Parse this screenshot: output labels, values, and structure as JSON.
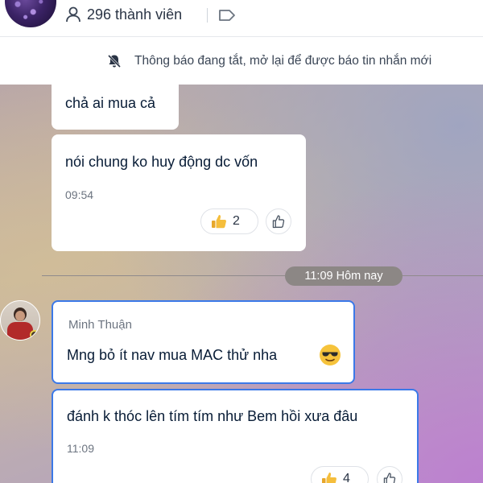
{
  "header": {
    "member_count": "296 thành viên"
  },
  "notice": {
    "text": "Thông báo đang tắt, mở lại để được báo tin nhắn mới"
  },
  "messages": [
    {
      "text": "chả ai mua cả"
    },
    {
      "text": "nói chung ko huy động dc vốn",
      "time": "09:54",
      "reaction_count": "2"
    }
  ],
  "divider": {
    "label": "11:09 Hôm nay"
  },
  "group_messages": {
    "sender": "Minh Thuận",
    "items": [
      {
        "text": "Mng bỏ ít nav mua MAC thử nha"
      },
      {
        "text": "đánh k thóc lên tím tím như Bem hồi xưa đâu",
        "time": "11:09",
        "reaction_count": "4"
      }
    ]
  },
  "icons": {
    "members": "person-icon",
    "tag": "tag-icon",
    "notifications_off": "bell-off-icon",
    "reaction": "thumbs-up-emoji",
    "react_button": "thumbs-up-outline-icon",
    "emoji": "sunglasses-emoji"
  },
  "colors": {
    "selection_border": "#3b79e8",
    "time_pill": "#8c8785"
  }
}
